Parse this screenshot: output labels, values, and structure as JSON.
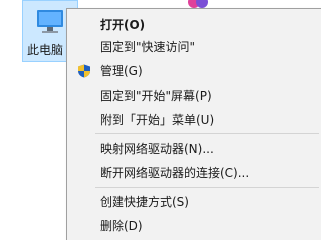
{
  "desktop": {
    "computer_icon_label": "此电脑"
  },
  "context_menu": {
    "items": [
      {
        "label": "打开(O)",
        "bold": true
      },
      {
        "label": "固定到\"快速访问\""
      },
      {
        "label": "管理(G)",
        "icon": "uac-shield-icon"
      },
      {
        "label": "固定到\"开始\"屏幕(P)"
      },
      {
        "label": "附到「开始」菜单(U)"
      },
      {
        "label": "映射网络驱动器(N)..."
      },
      {
        "label": "断开网络驱动器的连接(C)..."
      },
      {
        "label": "创建快捷方式(S)"
      },
      {
        "label": "删除(D)"
      }
    ]
  },
  "colors": {
    "selection_bg": "#cce8ff",
    "menu_bg": "#f2f2f2",
    "shield_blue": "#1f5fbf",
    "shield_yellow": "#f2c12e"
  }
}
